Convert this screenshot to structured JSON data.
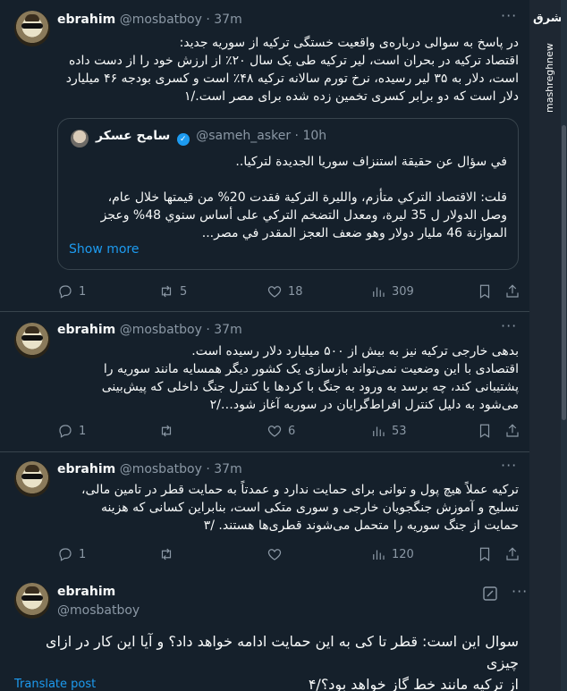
{
  "tweets": [
    {
      "name": "ebrahim",
      "handle": "@mosbatboy",
      "time": "37m",
      "text_lines": [
        "در پاسخ به سوالی درباره‌ی واقعیت خستگی ترکیه از سوریه جدید:",
        "اقتصاد ترکیه در بحران است، لیر ترکیه طی یک سال ۲۰٪ از ارزش خود را از دست داده",
        "است، دلار به ۳۵ لیر رسیده، نرخ تورم سالانه ترکیه ۴۸٪ است و کسری بودجه ۴۶ میلیارد",
        "دلار است که دو برابر کسری تخمین زده شده برای مصر است./۱"
      ],
      "quote": {
        "name": "سامح عسكر",
        "handle": "@sameh_asker",
        "time": "10h",
        "text_lines": [
          "في سؤال عن حقيقة استنزاف سوريا الجديدة لتركيا..",
          "",
          "قلت: الاقتصاد التركي متأزم، والليرة التركية فقدت 20% من قيمتها خلال عام،",
          "وصل الدولار ل 35 ليرة، ومعدل التضخم التركي على أساس سنوي 48% وعجز",
          "الموازنة 46 مليار دولار وهو ضعف العجز المقدر في مصر..."
        ],
        "show_more": "Show more"
      },
      "replies": "1",
      "retweets": "5",
      "likes": "18",
      "views": "309"
    },
    {
      "name": "ebrahim",
      "handle": "@mosbatboy",
      "time": "37m",
      "text_lines": [
        "بدهی خارجی ترکیه نیز به بیش از ۵۰۰ میلیارد دلار رسیده است.",
        "اقتصادی با این وضعیت نمی‌تواند بازسازی یک کشور دیگر همسایه مانند سوریه را",
        "پشتیبانی کند، چه برسد به ورود به جنگ با کردها یا کنترل جنگ داخلی که پیش‌بینی",
        "می‌شود به دلیل کنترل افراط‌گرایان در سوریه آغاز شود…/۲"
      ],
      "replies": "1",
      "retweets": "",
      "likes": "6",
      "views": "53"
    },
    {
      "name": "ebrahim",
      "handle": "@mosbatboy",
      "time": "37m",
      "text_lines": [
        "ترکیه عملاً هیچ پول و توانی برای حمایت ندارد و عمدتاً به حمایت قطر در تامین مالی،",
        "تسلیح و آموزش جنگجویان خارجی و سوری متکی است، بنابراین کسانی که هزینه",
        "حمایت از جنگ سوریه را متحمل می‌شوند قطری‌ها هستند. /۳"
      ],
      "replies": "1",
      "retweets": "",
      "likes": "",
      "views": "120"
    }
  ],
  "main_tweet": {
    "name": "ebrahim",
    "handle": "@mosbatboy",
    "text_lines": [
      "سوال این است: قطر تا کی به این حمایت ادامه خواهد داد؟ و آیا این کار در ازای چیزی",
      "از ترکیه مانند خط گاز خواهد بود؟/۴"
    ],
    "translate": "Translate post"
  },
  "watermark": {
    "logo_text": "مشرق",
    "url": "mashreghnews.ir"
  },
  "colors": {
    "background": "#15202b",
    "border": "#38444d",
    "muted": "#8b98a5",
    "accent": "#1d9bf0"
  }
}
